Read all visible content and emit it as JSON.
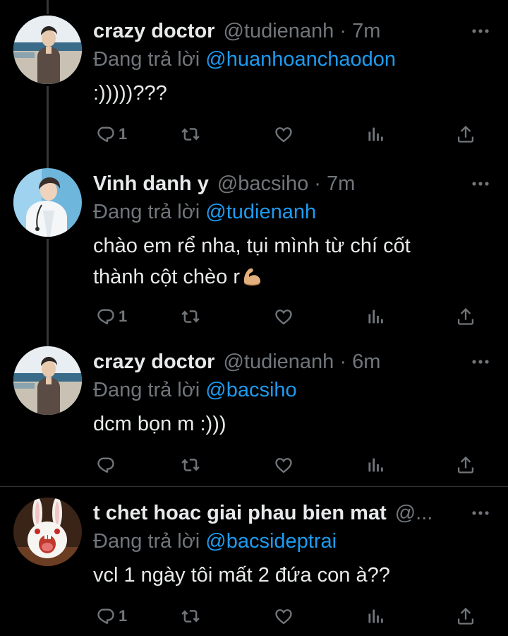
{
  "colors": {
    "background": "#000000",
    "text": "#e7e9ea",
    "muted": "#71767b",
    "mention": "#1d9bf0",
    "divider": "#2f3336"
  },
  "tweets": [
    {
      "name": "crazy doctor",
      "meta": "@tudienanh · 7m",
      "reply_prefix": "Đang trả lời ",
      "reply_to": "@huanhoanchaodon",
      "text": ":)))))???",
      "reply_count": "1",
      "avatar": "avatar-crazy-doctor"
    },
    {
      "name": "Vinh danh y",
      "meta": "@bacsiho · 7m",
      "reply_prefix": "Đang trả lời ",
      "reply_to": "@tudienanh",
      "text_line1": "chào em rể nha, tụi mình từ chí cốt",
      "text_line2": "thành cột chèo r",
      "emoji": "flexed-biceps-icon",
      "reply_count": "1",
      "avatar": "avatar-vinh-danh-y"
    },
    {
      "name": "crazy doctor",
      "meta": "@tudienanh · 6m",
      "reply_prefix": "Đang trả lời ",
      "reply_to": "@bacsiho",
      "text": "dcm bọn m :)))",
      "reply_count": "",
      "avatar": "avatar-crazy-doctor"
    },
    {
      "name": "t chet hoac giai phau bien mat",
      "meta": "@...",
      "reply_prefix": "Đang trả lời ",
      "reply_to": "@bacsideptrai",
      "text": "vcl 1 ngày tôi mất 2 đứa con à??",
      "reply_count": "1",
      "avatar": "avatar-rabbit"
    }
  ]
}
